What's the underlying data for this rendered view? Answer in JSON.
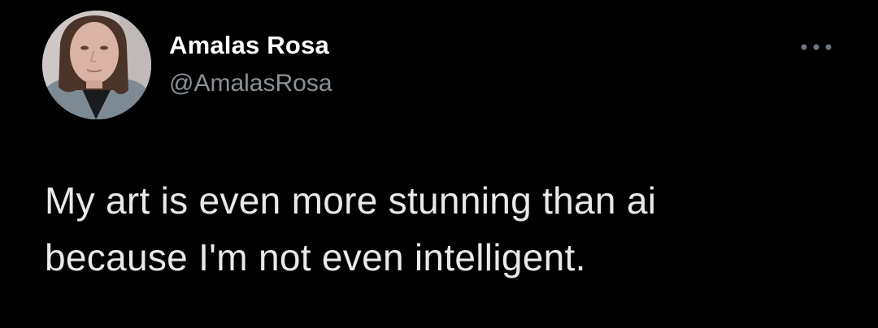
{
  "user": {
    "display_name": "Amalas Rosa",
    "handle": "@AmalasRosa",
    "avatar_icon": "profile-photo"
  },
  "tweet": {
    "text_lines": [
      "My art is even more stunning than ai",
      "because I'm not even intelligent."
    ]
  },
  "actions": {
    "more_icon": "more-horizontal-icon"
  },
  "colors": {
    "background": "#000000",
    "name": "#ffffff",
    "handle": "#8b9196",
    "text": "#e7e9ea"
  }
}
